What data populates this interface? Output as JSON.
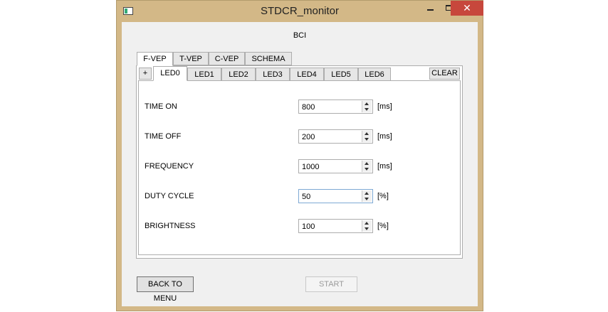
{
  "window": {
    "title": "STDCR_monitor",
    "close_glyph": "✕"
  },
  "header": {
    "label": "BCI"
  },
  "mode_tabs": [
    "F-VEP",
    "T-VEP",
    "C-VEP",
    "SCHEMA"
  ],
  "led_tabs": [
    "LED0",
    "LED1",
    "LED2",
    "LED3",
    "LED4",
    "LED5",
    "LED6"
  ],
  "add_button": "+",
  "clear_button": "CLEAR",
  "fields": [
    {
      "label": "TIME ON",
      "value": "800",
      "unit": "[ms]"
    },
    {
      "label": "TIME OFF",
      "value": "200",
      "unit": "[ms]"
    },
    {
      "label": "FREQUENCY",
      "value": "1000",
      "unit": "[ms]"
    },
    {
      "label": "DUTY CYCLE",
      "value": "50",
      "unit": "[%]"
    },
    {
      "label": "BRIGHTNESS",
      "value": "100",
      "unit": "[%]"
    }
  ],
  "footer": {
    "back_label": "BACK TO MENU",
    "start_label": "START"
  },
  "colors": {
    "frame": "#d3b887",
    "close": "#c7473c",
    "focus": "#7ea9d4"
  }
}
